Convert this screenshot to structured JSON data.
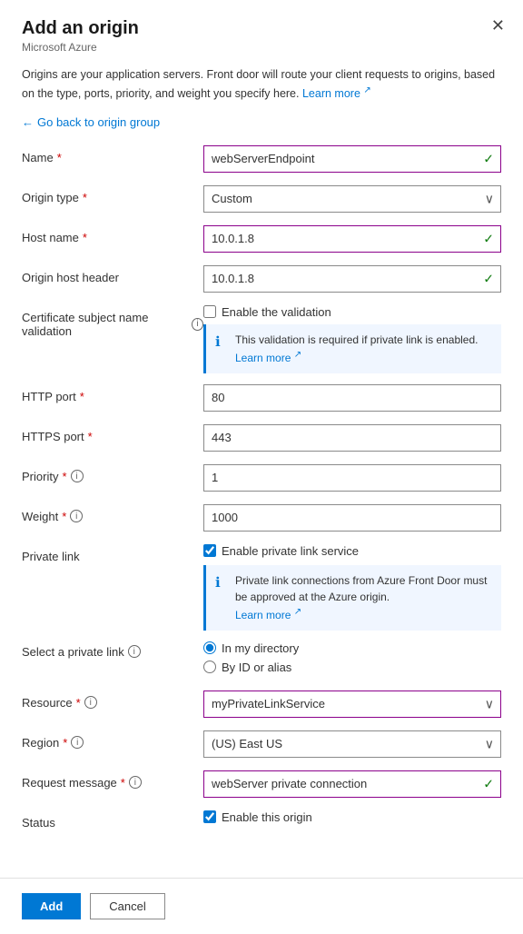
{
  "panel": {
    "title": "Add an origin",
    "subtitle": "Microsoft Azure",
    "description": "Origins are your application servers. Front door will route your client requests to origins, based on the type, ports, priority, and weight you specify here.",
    "description_link": "Learn more",
    "back_label": "Go back to origin group"
  },
  "form": {
    "name_label": "Name",
    "name_value": "webServerEndpoint",
    "origin_type_label": "Origin type",
    "origin_type_value": "Custom",
    "host_name_label": "Host name",
    "host_name_value": "10.0.1.8",
    "origin_host_header_label": "Origin host header",
    "origin_host_header_value": "10.0.1.8",
    "cert_validation_label": "Certificate subject name validation",
    "cert_validation_checkbox": "Enable the validation",
    "cert_info_text": "This validation is required if private link is enabled.",
    "cert_info_link": "Learn more",
    "http_port_label": "HTTP port",
    "http_port_value": "80",
    "https_port_label": "HTTPS port",
    "https_port_value": "443",
    "priority_label": "Priority",
    "priority_value": "1",
    "weight_label": "Weight",
    "weight_value": "1000",
    "private_link_label": "Private link",
    "private_link_checkbox": "Enable private link service",
    "private_link_info": "Private link connections from Azure Front Door must be approved at the Azure origin.",
    "private_link_info_link": "Learn more",
    "select_private_link_label": "Select a private link",
    "radio_directory": "In my directory",
    "radio_id": "By ID or alias",
    "resource_label": "Resource",
    "resource_value": "myPrivateLinkService",
    "region_label": "Region",
    "region_value": "(US) East US",
    "request_message_label": "Request message",
    "request_message_value": "webServer private connection",
    "status_label": "Status",
    "status_checkbox": "Enable this origin"
  },
  "footer": {
    "add_label": "Add",
    "cancel_label": "Cancel"
  }
}
